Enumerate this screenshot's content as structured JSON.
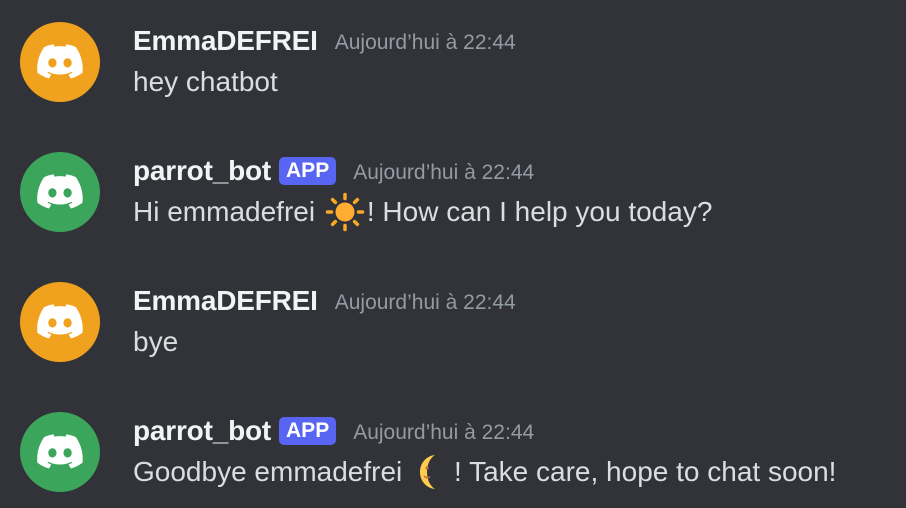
{
  "messages": [
    {
      "username": "EmmaDEFREI",
      "timestamp": "Aujourd’hui à 22:44",
      "text": "hey chatbot",
      "avatar_color": "#f0a21f",
      "avatar_icon": "discord-logo-icon"
    },
    {
      "username": "parrot_bot",
      "badge": "APP",
      "timestamp": "Aujourd’hui à 22:44",
      "text_before": "Hi emmadefrei ",
      "emoji": "sun-icon",
      "text_after": "! How can I help you today?",
      "avatar_color": "#3ba55c",
      "avatar_icon": "discord-logo-icon"
    },
    {
      "username": "EmmaDEFREI",
      "timestamp": "Aujourd’hui à 22:44",
      "text": "bye",
      "avatar_color": "#f0a21f",
      "avatar_icon": "discord-logo-icon"
    },
    {
      "username": "parrot_bot",
      "badge": "APP",
      "timestamp": "Aujourd’hui à 22:44",
      "text_before": "Goodbye emmadefrei ",
      "emoji": "crescent-moon-icon",
      "text_after": "! Take care, hope to chat soon!",
      "avatar_color": "#3ba55c",
      "avatar_icon": "discord-logo-icon"
    }
  ],
  "colors": {
    "background": "#313338",
    "username": "#f2f3f5",
    "timestamp": "#949ba4",
    "message_text": "#dbdee1",
    "app_badge": "#5865f2"
  }
}
